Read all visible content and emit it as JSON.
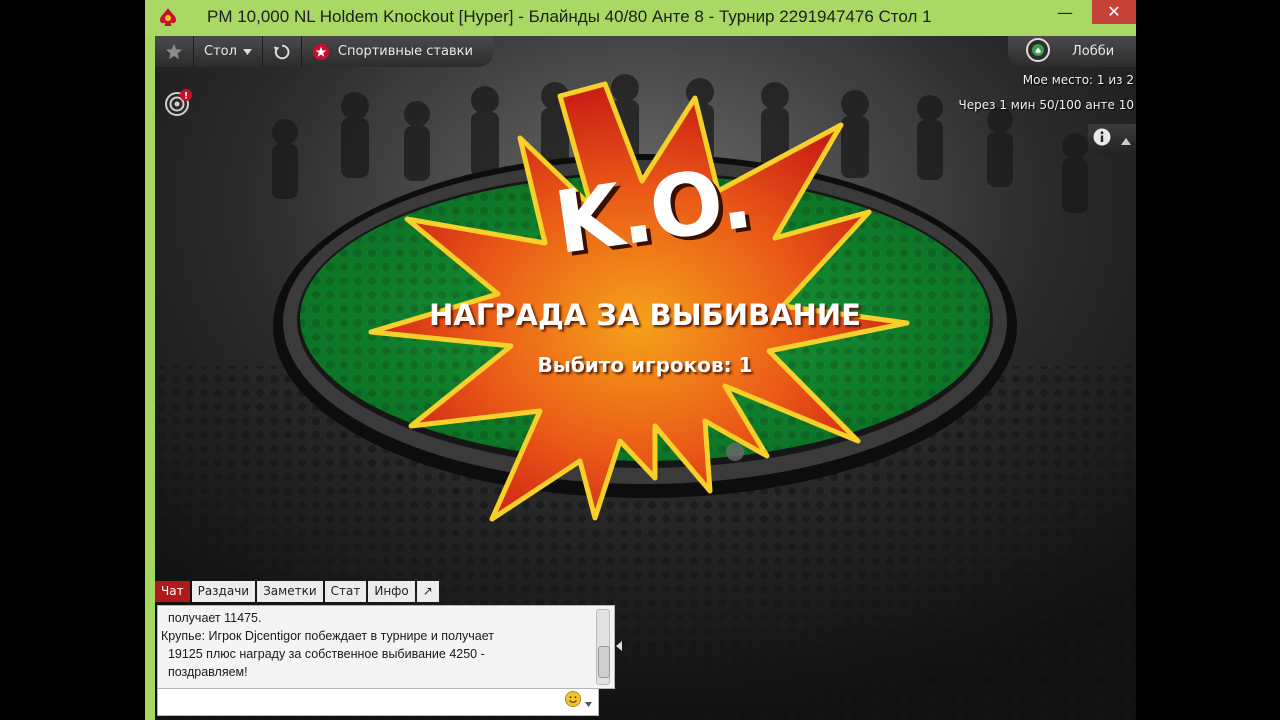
{
  "window": {
    "title": "PM 10,000 NL Holdem Knockout [Hyper] - Блайнды 40/80 Анте 8 - Турнир 2291947476 Стол 1",
    "buttons": {
      "minimize": "—",
      "maximize": "☐",
      "close": "✕"
    },
    "accent_color": "#a9d964"
  },
  "toolbar": {
    "favorite_icon": "star-icon",
    "table_menu_label": "Стол",
    "refresh_icon": "rebuy-icon",
    "sports_label": "Спортивные ставки",
    "lobby_label": "Лобби"
  },
  "status": {
    "my_place": "Мое место: 1 из 2",
    "next_level": "Через 1 мин 50/100 анте 10"
  },
  "ko": {
    "logo_text": "K.O.",
    "title": "НАГРАДА ЗА ВЫБИВАНИЕ",
    "subtitle": "Выбито игроков: 1"
  },
  "chat": {
    "tabs": [
      {
        "label": "Чат",
        "active": true
      },
      {
        "label": "Раздачи",
        "active": false
      },
      {
        "label": "Заметки",
        "active": false
      },
      {
        "label": "Стат",
        "active": false
      },
      {
        "label": "Инфо",
        "active": false
      },
      {
        "label": "↗",
        "active": false
      }
    ],
    "lines": [
      "  получает 11475.",
      "Крупье: Игрок Djcentigor побеждает в турнире и получает",
      "  19125 плюс награду за собственное выбивание 4250 -",
      "  поздравляем!"
    ],
    "input_value": "",
    "emoji_icon": "smiley-icon"
  }
}
